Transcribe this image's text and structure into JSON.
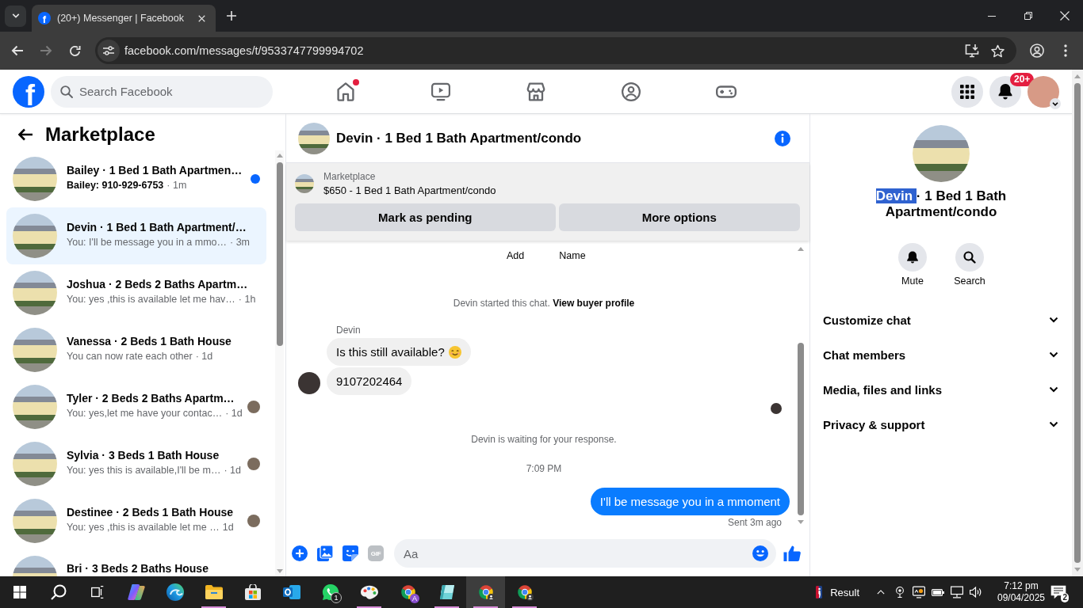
{
  "browser": {
    "tabs": [
      {
        "favicon": "f",
        "title": "(20+) Messenger | Facebook",
        "selected": true
      }
    ],
    "nav_buttons": [
      {
        "kind": "back",
        "disabled": false
      },
      {
        "kind": "forward",
        "disabled": true
      },
      {
        "kind": "reload",
        "disabled": false
      }
    ],
    "url": "facebook.com/messages/t/9533747799994702"
  },
  "header": {
    "logo": "f",
    "search": {
      "placeholder": "Search Facebook"
    },
    "nav": [
      {
        "kind": "home",
        "dot": true
      },
      {
        "kind": "video",
        "dot": false
      },
      {
        "kind": "marketplace",
        "dot": false
      },
      {
        "kind": "groups",
        "dot": false
      },
      {
        "kind": "gaming",
        "dot": false
      }
    ],
    "notifications_badge": "20+"
  },
  "sidebar": {
    "title": "Marketplace",
    "chats": [
      {
        "title": "Bailey · 1 Bed 1 Bath Apartmen…",
        "preview": "Bailey: 910-929-6753",
        "time": "· 1m",
        "unread": true,
        "selected": false,
        "seen": false
      },
      {
        "title": "Devin · 1 Bed 1 Bath Apartment/…",
        "preview": "You: I'll be message you in a mmo…",
        "time": "· 3m",
        "unread": false,
        "selected": true,
        "seen": false
      },
      {
        "title": "Joshua · 2 Beds 2 Baths Apartm…",
        "preview": "You: yes ,this is available let me hav…",
        "time": "· 1h",
        "unread": false,
        "selected": false,
        "seen": false
      },
      {
        "title": "Vanessa · 2 Beds 1 Bath House",
        "preview": "You can now rate each other",
        "time": "· 1d",
        "unread": false,
        "selected": false,
        "seen": false
      },
      {
        "title": "Tyler · 2 Beds 2 Baths Apartm…",
        "preview": "You: yes,let me have your contac…",
        "time": "· 1d",
        "unread": false,
        "selected": false,
        "seen": true
      },
      {
        "title": "Sylvia · 3 Beds 1 Bath House",
        "preview": "You: yes this is available,I'll be m…",
        "time": "· 1d",
        "unread": false,
        "selected": false,
        "seen": true
      },
      {
        "title": "Destinee · 2 Beds 1 Bath House",
        "preview": "You: yes ,this is available let me …",
        "time": "1d",
        "unread": false,
        "selected": false,
        "seen": true
      },
      {
        "title": "Bri · 3 Beds 2 Baths House",
        "unread": false,
        "selected": false,
        "seen": false
      }
    ]
  },
  "conversation": {
    "title": "Devin · 1 Bed 1 Bath Apartment/condo",
    "listing": {
      "label": "Marketplace",
      "title": "$650 - 1 Bed 1 Bath Apartment/condo",
      "actions": [
        "Mark as pending",
        "More options"
      ]
    },
    "quick_actions": [
      "Add",
      "Name"
    ],
    "messages": [
      {
        "kind": "system",
        "text": "Devin started this chat.",
        "link": "View buyer profile"
      },
      {
        "kind": "sender",
        "text": "Devin"
      },
      {
        "kind": "incoming",
        "text": "Is this still available?",
        "emoji": true,
        "avatar": false
      },
      {
        "kind": "incoming",
        "text": "9107202464",
        "emoji": false,
        "avatar": true
      },
      {
        "kind": "read_receipt"
      },
      {
        "kind": "system",
        "text": "Devin is waiting for your response."
      },
      {
        "kind": "time",
        "text": "7:09 PM"
      },
      {
        "kind": "outgoing",
        "text": "I'll be message you in a mmoment"
      },
      {
        "kind": "status",
        "text": "Sent 3m ago"
      }
    ],
    "composer": {
      "gif_label": "GIF",
      "placeholder": "Aa"
    }
  },
  "details": {
    "title": [
      {
        "text": "Devin ",
        "highlighted": true
      },
      {
        "text": "· 1 Bed 1 Bath Apartment/condo",
        "highlighted": false
      }
    ],
    "actions": [
      {
        "kind": "mute",
        "label": "Mute"
      },
      {
        "kind": "search",
        "label": "Search"
      }
    ],
    "sections": [
      {
        "label": "Customize chat",
        "expanded": false
      },
      {
        "label": "Chat members",
        "expanded": false
      },
      {
        "label": "Media, files and links",
        "expanded": false
      },
      {
        "label": "Privacy & support",
        "expanded": false
      }
    ]
  },
  "taskbar": {
    "apps": [
      {
        "kind": "start",
        "running": false,
        "active": false
      },
      {
        "kind": "search",
        "running": false,
        "active": false
      },
      {
        "kind": "task_view",
        "running": false,
        "active": false
      },
      {
        "kind": "copilot",
        "running": false,
        "active": false
      },
      {
        "kind": "edge",
        "running": false,
        "active": false
      },
      {
        "kind": "explorer",
        "running": true,
        "active": false
      },
      {
        "kind": "store",
        "running": false,
        "active": false
      },
      {
        "kind": "outlook",
        "running": false,
        "active": false
      },
      {
        "kind": "whatsapp",
        "running": false,
        "active": false,
        "badge": "1"
      },
      {
        "kind": "paint",
        "running": true,
        "active": false
      },
      {
        "kind": "chrome",
        "running": false,
        "active": false,
        "badge": "A"
      },
      {
        "kind": "viewer",
        "running": true,
        "active": false
      },
      {
        "kind": "chrome",
        "running": true,
        "active": true
      },
      {
        "kind": "chrome",
        "running": true,
        "active": false
      }
    ],
    "news": "Result",
    "time": "7:12 pm",
    "date": "09/04/2025",
    "notifications": "2"
  }
}
